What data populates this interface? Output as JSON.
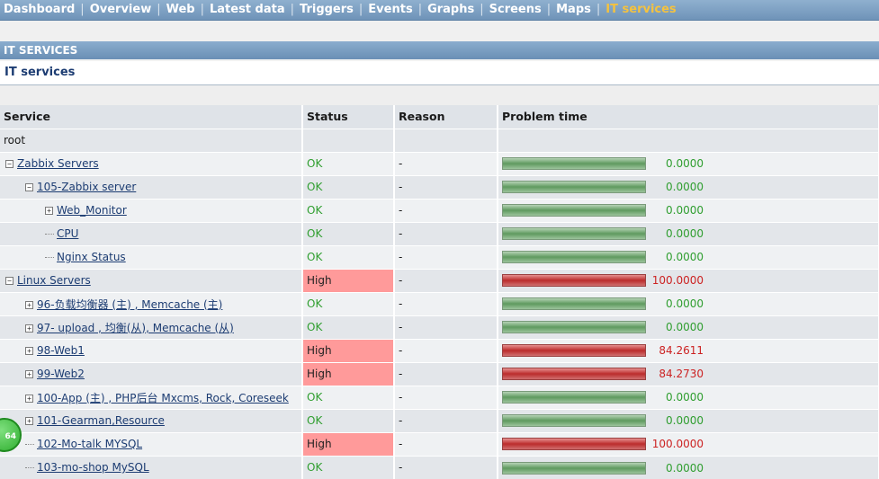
{
  "nav": {
    "items": [
      {
        "label": "Dashboard",
        "active": false
      },
      {
        "label": "Overview",
        "active": false
      },
      {
        "label": "Web",
        "active": false
      },
      {
        "label": "Latest data",
        "active": false
      },
      {
        "label": "Triggers",
        "active": false
      },
      {
        "label": "Events",
        "active": false
      },
      {
        "label": "Graphs",
        "active": false
      },
      {
        "label": "Screens",
        "active": false
      },
      {
        "label": "Maps",
        "active": false
      },
      {
        "label": "IT services",
        "active": true
      }
    ],
    "separator": "|"
  },
  "section_header": "IT SERVICES",
  "page_title": "IT services",
  "table": {
    "columns": [
      "Service",
      "Status",
      "Reason",
      "Problem time"
    ],
    "root_label": "root",
    "rows": [
      {
        "service": "Zabbix Servers",
        "level": 0,
        "expand": "-",
        "status": "OK",
        "reason": "-",
        "problem_time": "0.0000",
        "problem_pct": 0
      },
      {
        "service": "105-Zabbix server",
        "level": 1,
        "expand": "-",
        "status": "OK",
        "reason": "-",
        "problem_time": "0.0000",
        "problem_pct": 0
      },
      {
        "service": "Web_Monitor",
        "level": 2,
        "expand": "+",
        "status": "OK",
        "reason": "-",
        "problem_time": "0.0000",
        "problem_pct": 0
      },
      {
        "service": "CPU",
        "level": 2,
        "expand": "",
        "status": "OK",
        "reason": "-",
        "problem_time": "0.0000",
        "problem_pct": 0
      },
      {
        "service": "Nginx Status",
        "level": 2,
        "expand": "",
        "status": "OK",
        "reason": "-",
        "problem_time": "0.0000",
        "problem_pct": 0
      },
      {
        "service": "Linux Servers",
        "level": 0,
        "expand": "-",
        "status": "High",
        "reason": "-",
        "problem_time": "100.0000",
        "problem_pct": 100
      },
      {
        "service": "96-负载均衡器 (主) , Memcache (主)",
        "level": 1,
        "expand": "+",
        "status": "OK",
        "reason": "-",
        "problem_time": "0.0000",
        "problem_pct": 0
      },
      {
        "service": "97- upload , 均衡(从), Memcache (从)",
        "level": 1,
        "expand": "+",
        "status": "OK",
        "reason": "-",
        "problem_time": "0.0000",
        "problem_pct": 0
      },
      {
        "service": "98-Web1",
        "level": 1,
        "expand": "+",
        "status": "High",
        "reason": "-",
        "problem_time": "84.2611",
        "problem_pct": 84.2611
      },
      {
        "service": "99-Web2",
        "level": 1,
        "expand": "+",
        "status": "High",
        "reason": "-",
        "problem_time": "84.2730",
        "problem_pct": 84.273
      },
      {
        "service": "100-App (主) , PHP后台 Mxcms, Rock, Coreseek",
        "level": 1,
        "expand": "+",
        "status": "OK",
        "reason": "-",
        "problem_time": "0.0000",
        "problem_pct": 0
      },
      {
        "service": "101-Gearman,Resource",
        "level": 1,
        "expand": "+",
        "status": "OK",
        "reason": "-",
        "problem_time": "0.0000",
        "problem_pct": 0
      },
      {
        "service": "102-Mo-talk MYSQL",
        "level": 1,
        "expand": "",
        "status": "High",
        "reason": "-",
        "problem_time": "100.0000",
        "problem_pct": 100
      },
      {
        "service": "103-mo-shop MySQL",
        "level": 1,
        "expand": "",
        "status": "OK",
        "reason": "-",
        "problem_time": "0.0000",
        "problem_pct": 0
      }
    ]
  },
  "badge": {
    "text": "64"
  },
  "colors": {
    "ok": "#2f9e2f",
    "high_bg": "#ff9a9a",
    "bad_text": "#cc2222",
    "nav_active": "#f4c23f"
  }
}
